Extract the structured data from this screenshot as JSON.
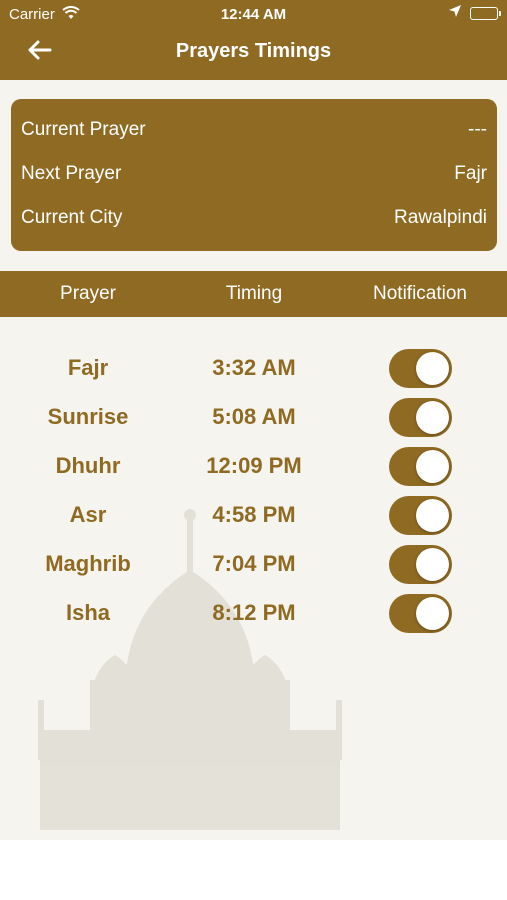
{
  "status_bar": {
    "carrier": "Carrier",
    "time": "12:44 AM"
  },
  "header": {
    "title": "Prayers Timings"
  },
  "info": {
    "current_prayer_label": "Current Prayer",
    "current_prayer_value": "---",
    "next_prayer_label": "Next Prayer",
    "next_prayer_value": "Fajr",
    "current_city_label": "Current City",
    "current_city_value": "Rawalpindi"
  },
  "columns": {
    "prayer": "Prayer",
    "timing": "Timing",
    "notification": "Notification"
  },
  "prayers": [
    {
      "name": "Fajr",
      "time": "3:32 AM",
      "notification": true
    },
    {
      "name": "Sunrise",
      "time": "5:08 AM",
      "notification": true
    },
    {
      "name": "Dhuhr",
      "time": "12:09 PM",
      "notification": true
    },
    {
      "name": "Asr",
      "time": "4:58 PM",
      "notification": true
    },
    {
      "name": "Maghrib",
      "time": "7:04 PM",
      "notification": true
    },
    {
      "name": "Isha",
      "time": "8:12 PM",
      "notification": true
    }
  ],
  "colors": {
    "brand": "#8f6a22",
    "background": "#f6f4ee"
  }
}
